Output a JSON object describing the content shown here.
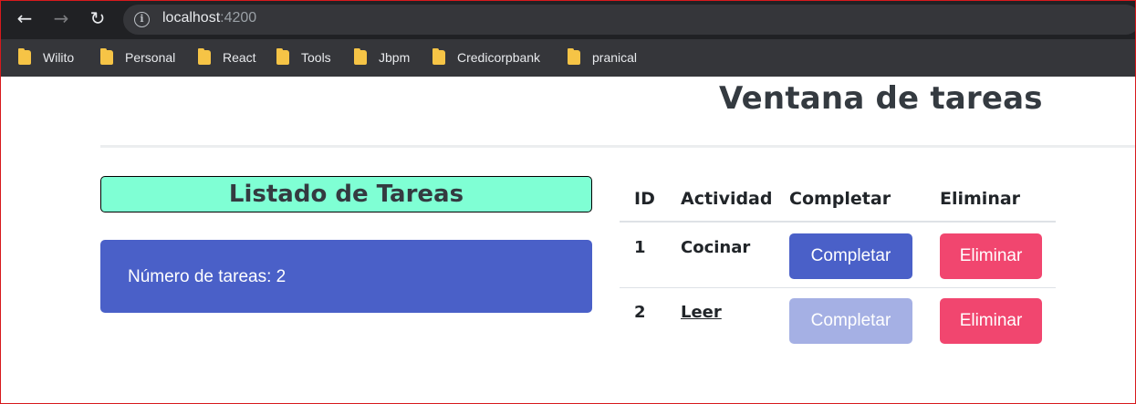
{
  "browser": {
    "url_host": "localhost",
    "url_port": ":4200",
    "bookmarks": [
      "Wilito",
      "Personal",
      "React",
      "Tools",
      "Jbpm",
      "Credicorpbank",
      "pranical"
    ]
  },
  "page": {
    "title": "Ventana de tareas",
    "list_title": "Listado de Tareas",
    "count_text": "Número de tareas: 2"
  },
  "table": {
    "headers": [
      "ID",
      "Actividad",
      "Completar",
      "Eliminar"
    ],
    "rows": [
      {
        "id": "1",
        "activity": "Cocinar",
        "complete_label": "Completar",
        "delete_label": "Eliminar",
        "completed": false
      },
      {
        "id": "2",
        "activity": "Leer",
        "complete_label": "Completar",
        "delete_label": "Eliminar",
        "completed": true
      }
    ]
  },
  "colors": {
    "accent": "#4a60c8",
    "danger": "#f1466f",
    "title_bg": "#7fffd4"
  }
}
